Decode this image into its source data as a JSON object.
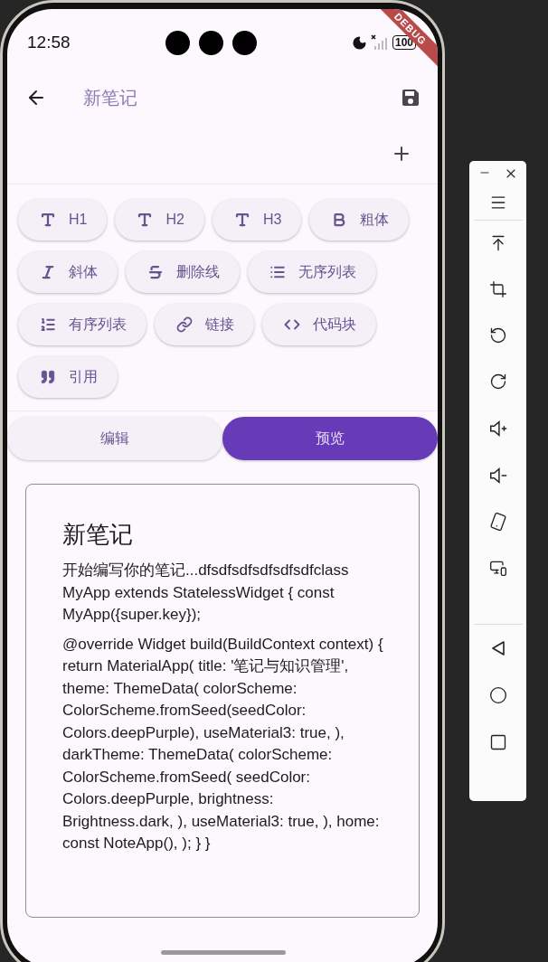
{
  "status_bar": {
    "time": "12:58",
    "battery": "100"
  },
  "debug_banner": "DEBUG",
  "app_bar": {
    "title": "新笔记"
  },
  "toolbar": [
    {
      "kind": "heading",
      "label": "H1"
    },
    {
      "kind": "heading",
      "label": "H2"
    },
    {
      "kind": "heading",
      "label": "H3"
    },
    {
      "kind": "bold",
      "label": "粗体"
    },
    {
      "kind": "italic",
      "label": "斜体"
    },
    {
      "kind": "strikethrough",
      "label": "删除线"
    },
    {
      "kind": "bullet-list",
      "label": "无序列表"
    },
    {
      "kind": "numbered-list",
      "label": "有序列表"
    },
    {
      "kind": "link",
      "label": "链接"
    },
    {
      "kind": "code",
      "label": "代码块"
    },
    {
      "kind": "quote",
      "label": "引用"
    }
  ],
  "mode_tabs": [
    {
      "label": "编辑",
      "selected": false
    },
    {
      "label": "预览",
      "selected": true
    }
  ],
  "preview": {
    "title": "新笔记",
    "paragraphs": [
      "开始编写你的笔记...dfsdfsdfsdfsdfsdfclass MyApp extends StatelessWidget { const MyApp({super.key});",
      "@override Widget build(BuildContext context) { return MaterialApp( title: '笔记与知识管理', theme: ThemeData( colorScheme: ColorScheme.fromSeed(seedColor: Colors.deepPurple), useMaterial3: true, ), darkTheme: ThemeData( colorScheme: ColorScheme.fromSeed( seedColor: Colors.deepPurple, brightness: Brightness.dark, ), useMaterial3: true, ), home: const NoteApp(), ); } }"
    ]
  }
}
